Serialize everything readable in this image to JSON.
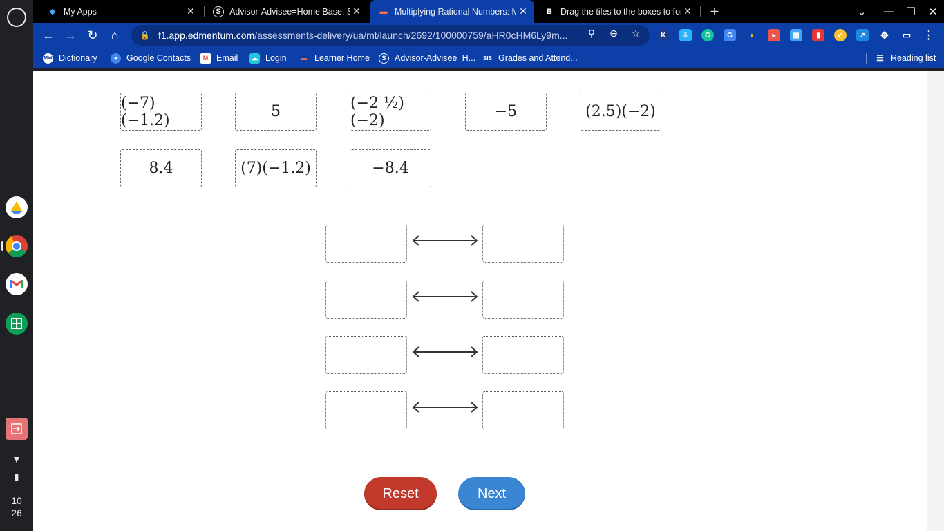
{
  "shelf": {
    "clock_hour": "10",
    "clock_minute": "26"
  },
  "tabs": [
    {
      "title": "My Apps",
      "icon": "edmentum-icon",
      "active": false
    },
    {
      "title": "Advisor-Advisee=Home Base: Se",
      "icon": "schoology-icon",
      "active": false
    },
    {
      "title": "Multiplying Rational Numbers: M",
      "icon": "edmentum-icon",
      "active": true
    },
    {
      "title": "Drag the tiles to the boxes to for",
      "icon": "brainly-icon",
      "active": false
    }
  ],
  "omnibox": {
    "host": "f1.app.edmentum.com",
    "path": "/assessments-delivery/ua/mt/launch/2692/100000759/aHR0cHM6Ly9m..."
  },
  "bookmarks": [
    {
      "label": "Dictionary",
      "icon": "merriam-webster-icon"
    },
    {
      "label": "Google Contacts",
      "icon": "contacts-icon"
    },
    {
      "label": "Email",
      "icon": "gmail-icon"
    },
    {
      "label": "Login",
      "icon": "cloud-icon"
    },
    {
      "label": "Learner Home",
      "icon": "edmentum-icon"
    },
    {
      "label": "Advisor-Advisee=H...",
      "icon": "schoology-icon"
    },
    {
      "label": "Grades and Attend...",
      "icon": "sis-icon"
    }
  ],
  "reading_list": "Reading list",
  "tiles": [
    "(−7)(−1.2)",
    "5",
    "(−2 ½)(−2)",
    "−5",
    "(2.5)(−2)",
    "8.4",
    "(7)(−1.2)",
    "−8.4"
  ],
  "buttons": {
    "reset": "Reset",
    "next": "Next"
  }
}
